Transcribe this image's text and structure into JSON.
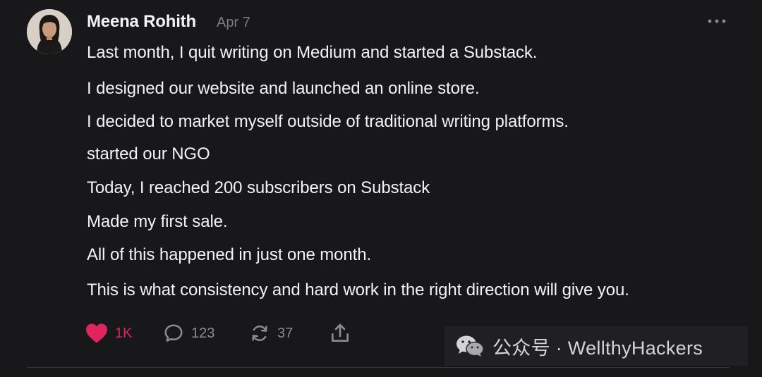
{
  "post": {
    "author": "Meena Rohith",
    "date": "Apr 7",
    "lines": [
      "Last month, I quit writing on Medium and started a Substack.",
      "I designed our website and launched an online store.",
      "I decided to market myself outside of traditional writing platforms.",
      "started our NGO",
      "Today, I reached 200 subscribers on Substack",
      "Made my first sale.",
      "All of this happened in just one month.",
      "This is what consistency and hard work in the right direction will give you."
    ]
  },
  "actions": {
    "like_count": "1K",
    "reply_count": "123",
    "repost_count": "37"
  },
  "watermark": {
    "text": "公众号 · WellthyHackers"
  },
  "colors": {
    "background": "#18181b",
    "like_red": "#e0245e",
    "muted": "#8b8b90"
  },
  "icons": [
    "more-icon",
    "heart-icon",
    "reply-icon",
    "repost-icon",
    "share-icon",
    "wechat-icon"
  ]
}
